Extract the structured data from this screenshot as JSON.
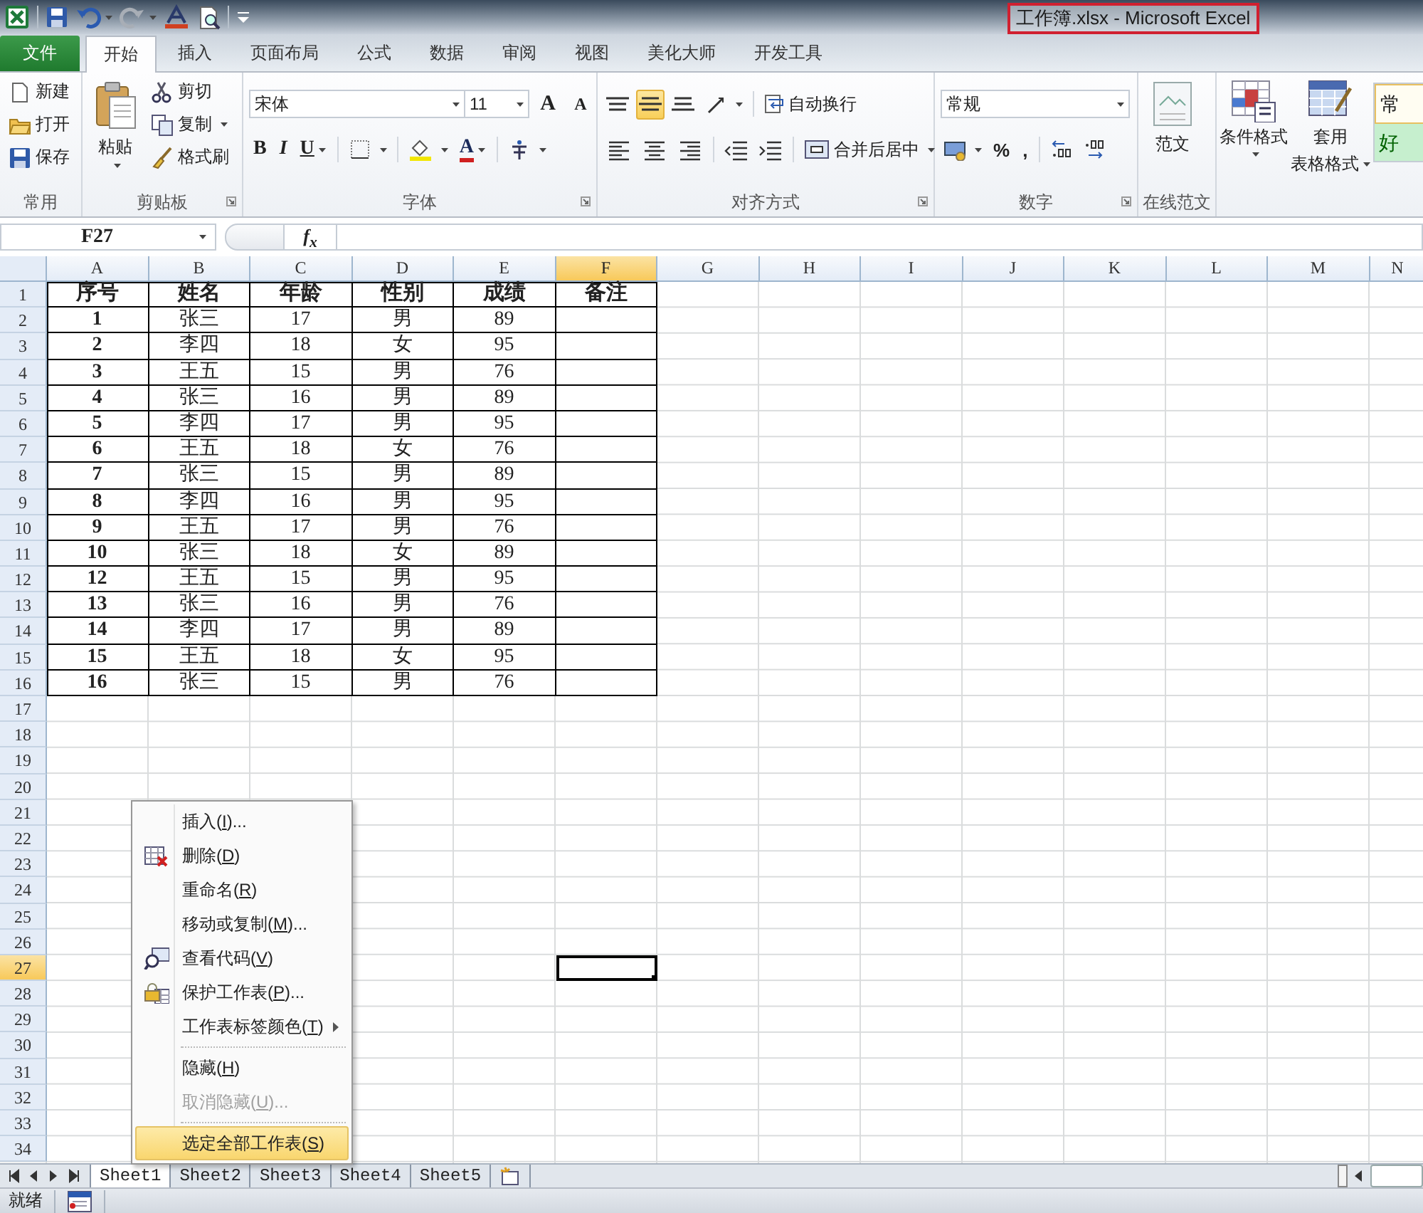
{
  "title_bar": {
    "title": "工作簿.xlsx - Microsoft Excel"
  },
  "ribbon_tabs": [
    {
      "label": "文件",
      "kind": "file",
      "selected": false
    },
    {
      "label": "开始",
      "kind": "tab",
      "selected": true
    },
    {
      "label": "插入",
      "kind": "tab",
      "selected": false
    },
    {
      "label": "页面布局",
      "kind": "tab",
      "selected": false
    },
    {
      "label": "公式",
      "kind": "tab",
      "selected": false
    },
    {
      "label": "数据",
      "kind": "tab",
      "selected": false
    },
    {
      "label": "审阅",
      "kind": "tab",
      "selected": false
    },
    {
      "label": "视图",
      "kind": "tab",
      "selected": false
    },
    {
      "label": "美化大师",
      "kind": "tab",
      "selected": false
    },
    {
      "label": "开发工具",
      "kind": "tab",
      "selected": false
    }
  ],
  "ribbon_groups": [
    {
      "kind": "common",
      "label": "常用",
      "buttons": [
        "新建",
        "打开",
        "保存"
      ]
    },
    {
      "kind": "clipboard",
      "label": "剪贴板",
      "paste": "粘贴",
      "buttons": [
        "剪切",
        "复制",
        "格式刷"
      ]
    },
    {
      "kind": "font",
      "label": "字体",
      "font_name": "宋体",
      "font_size": "11",
      "size_buttons": [
        "A",
        "A"
      ],
      "style_buttons": [
        "B",
        "I",
        "U"
      ],
      "font_color": "A"
    },
    {
      "kind": "alignment",
      "label": "对齐方式",
      "vertical_align": [
        {
          "selected": false
        },
        {
          "selected": true
        },
        {
          "selected": false
        }
      ],
      "buttons": [
        "自动换行",
        "合并后居中"
      ]
    },
    {
      "kind": "number",
      "label": "数字",
      "format": "常规",
      "buttons": [
        "%",
        ","
      ]
    },
    {
      "kind": "online",
      "label": "在线范文",
      "buttons": [
        "范文"
      ]
    },
    {
      "kind": "styles",
      "buttons": [
        [
          "条件格式"
        ],
        [
          "套用",
          "表格格式"
        ]
      ],
      "cell_styles": [
        "常",
        "好"
      ]
    }
  ],
  "formula_bar": {
    "name_box": "F27",
    "function_label": "f$_{x}$"
  },
  "sheet": {
    "columns": [
      {
        "label": "A",
        "selected": false
      },
      {
        "label": "B",
        "selected": false
      },
      {
        "label": "C",
        "selected": false
      },
      {
        "label": "D",
        "selected": false
      },
      {
        "label": "E",
        "selected": false
      },
      {
        "label": "F",
        "selected": true
      },
      {
        "label": "G",
        "selected": false
      },
      {
        "label": "H",
        "selected": false
      },
      {
        "label": "I",
        "selected": false
      },
      {
        "label": "J",
        "selected": false
      },
      {
        "label": "K",
        "selected": false
      },
      {
        "label": "L",
        "selected": false
      },
      {
        "label": "M",
        "selected": false
      },
      {
        "label": "N",
        "selected": false
      }
    ],
    "rows": [
      {
        "label": "1",
        "selected": false
      },
      {
        "label": "2",
        "selected": false
      },
      {
        "label": "3",
        "selected": false
      },
      {
        "label": "4",
        "selected": false
      },
      {
        "label": "5",
        "selected": false
      },
      {
        "label": "6",
        "selected": false
      },
      {
        "label": "7",
        "selected": false
      },
      {
        "label": "8",
        "selected": false
      },
      {
        "label": "9",
        "selected": false
      },
      {
        "label": "10",
        "selected": false
      },
      {
        "label": "11",
        "selected": false
      },
      {
        "label": "12",
        "selected": false
      },
      {
        "label": "13",
        "selected": false
      },
      {
        "label": "14",
        "selected": false
      },
      {
        "label": "15",
        "selected": false
      },
      {
        "label": "16",
        "selected": false
      },
      {
        "label": "17",
        "selected": false
      },
      {
        "label": "18",
        "selected": false
      },
      {
        "label": "19",
        "selected": false
      },
      {
        "label": "20",
        "selected": false
      },
      {
        "label": "21",
        "selected": false
      },
      {
        "label": "22",
        "selected": false
      },
      {
        "label": "23",
        "selected": false
      },
      {
        "label": "24",
        "selected": false
      },
      {
        "label": "25",
        "selected": false
      },
      {
        "label": "26",
        "selected": false
      },
      {
        "label": "27",
        "selected": true
      },
      {
        "label": "28",
        "selected": false
      },
      {
        "label": "29",
        "selected": false
      },
      {
        "label": "30",
        "selected": false
      },
      {
        "label": "31",
        "selected": false
      },
      {
        "label": "32",
        "selected": false
      },
      {
        "label": "33",
        "selected": false
      },
      {
        "label": "34",
        "selected": false
      }
    ],
    "header": [
      "序号",
      "姓名",
      "年龄",
      "性别",
      "成绩",
      "备注"
    ],
    "records": [
      [
        "1",
        "张三",
        "17",
        "男",
        "89"
      ],
      [
        "2",
        "李四",
        "18",
        "女",
        "95"
      ],
      [
        "3",
        "王五",
        "15",
        "男",
        "76"
      ],
      [
        "4",
        "张三",
        "16",
        "男",
        "89"
      ],
      [
        "5",
        "李四",
        "17",
        "男",
        "95"
      ],
      [
        "6",
        "王五",
        "18",
        "女",
        "76"
      ],
      [
        "7",
        "张三",
        "15",
        "男",
        "89"
      ],
      [
        "8",
        "李四",
        "16",
        "男",
        "95"
      ],
      [
        "9",
        "王五",
        "17",
        "男",
        "76"
      ],
      [
        "10",
        "张三",
        "18",
        "女",
        "89"
      ],
      [
        "12",
        "王五",
        "15",
        "男",
        "95"
      ],
      [
        "13",
        "张三",
        "16",
        "男",
        "76"
      ],
      [
        "14",
        "李四",
        "17",
        "男",
        "89"
      ],
      [
        "15",
        "王五",
        "18",
        "女",
        "95"
      ],
      [
        "16",
        "张三",
        "15",
        "男",
        "76"
      ]
    ]
  },
  "context_menu": {
    "items": [
      {
        "kind": "command",
        "before": "插入(",
        "key": "I",
        "after": ")...",
        "selected": false,
        "disabled": false,
        "submenu": false
      },
      {
        "kind": "command",
        "before": "删除(",
        "key": "D",
        "after": ")",
        "selected": false,
        "disabled": false,
        "submenu": false
      },
      {
        "kind": "command",
        "before": "重命名(",
        "key": "R",
        "after": ")",
        "selected": false,
        "disabled": false,
        "submenu": false
      },
      {
        "kind": "command",
        "before": "移动或复制(",
        "key": "M",
        "after": ")...",
        "selected": false,
        "disabled": false,
        "submenu": false
      },
      {
        "kind": "command",
        "before": "查看代码(",
        "key": "V",
        "after": ")",
        "selected": false,
        "disabled": false,
        "submenu": false
      },
      {
        "kind": "command",
        "before": "保护工作表(",
        "key": "P",
        "after": ")...",
        "selected": false,
        "disabled": false,
        "submenu": false
      },
      {
        "kind": "command",
        "before": "工作表标签颜色(",
        "key": "T",
        "after": ")",
        "selected": false,
        "disabled": false,
        "submenu": true
      },
      {
        "kind": "separator"
      },
      {
        "kind": "command",
        "before": "隐藏(",
        "key": "H",
        "after": ")",
        "selected": false,
        "disabled": false,
        "submenu": false
      },
      {
        "kind": "command",
        "before": "取消隐藏(",
        "key": "U",
        "after": ")...",
        "selected": false,
        "disabled": true,
        "submenu": false
      },
      {
        "kind": "separator"
      },
      {
        "kind": "command",
        "before": "选定全部工作表(",
        "key": "S",
        "after": ")",
        "selected": true,
        "disabled": false,
        "submenu": false
      }
    ]
  },
  "sheet_tabs": [
    {
      "label": "Sheet1",
      "selected": true
    },
    {
      "label": "Sheet2",
      "selected": false
    },
    {
      "label": "Sheet3",
      "selected": false
    },
    {
      "label": "Sheet4",
      "selected": false
    },
    {
      "label": "Sheet5",
      "selected": false
    }
  ],
  "status_bar": {
    "text": "就绪"
  }
}
